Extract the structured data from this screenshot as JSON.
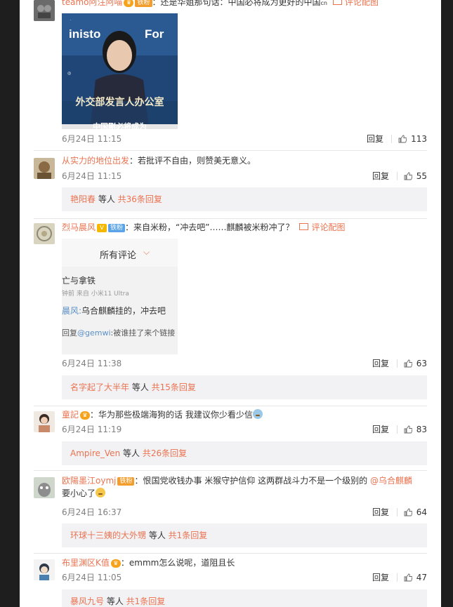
{
  "comments": [
    {
      "user": "teamo阿注阿喵",
      "badge": "铁粉",
      "text": "：还是华姐那句话：中国必将成为更好的中国",
      "cn": "cn",
      "pic_link": "评论配图",
      "image": {
        "banner_top": "inisto",
        "banner_right": "For",
        "caption": "外交部发言人办公室",
        "bottom_text": "中国剛必将成为"
      },
      "time": "6月24日 11:15",
      "reply_label": "回复",
      "likes": "113"
    },
    {
      "user": "从实力的地位出发",
      "text": "：若批评不自由，则赞美无意义。",
      "time": "6月24日 11:15",
      "reply_label": "回复",
      "likes": "55",
      "sub": {
        "user": "艳阳春",
        "etc": " 等人 ",
        "count": "共36条回复"
      }
    },
    {
      "user": "烈马晨风",
      "badge": "铁粉",
      "text": "：来自米粉，“冲去吧”……麒麟被米粉冲了？",
      "pic_link": "评论配图",
      "image": {
        "header": "所有评论",
        "line1": "亡与拿铁",
        "line2": "钟前  来自 小米11 Ultra",
        "line3_user": "晨风:",
        "line3": "乌合麒麟挂的，冲去吧",
        "line4_prefix": "回复",
        "line4_user": "@gemwi",
        "line4": ":被谁挂了来个链接"
      },
      "time": "6月24日 11:38",
      "reply_label": "回复",
      "likes": "63",
      "sub": {
        "user": "名字起了大半年",
        "etc": " 等人 ",
        "count": "共15条回复"
      }
    },
    {
      "user": "童記",
      "text": "：华为那些极端海狗的话 我建议你少看少信",
      "time": "6月24日 11:19",
      "reply_label": "回复",
      "likes": "83",
      "sub": {
        "user": "Ampire_Ven",
        "etc": " 等人 ",
        "count": "共26条回复"
      }
    },
    {
      "user": "欧陽墨江oymj",
      "badge": "铁粉",
      "text": "：恨国党收钱办事 米猴守护信仰 这两群战斗力不是一个级别的 ",
      "mention": "@乌合麒麟",
      "text2": "要小心了",
      "time": "6月24日 16:37",
      "reply_label": "回复",
      "likes": "64",
      "sub": {
        "user": "环球十三姨的大外甥",
        "etc": " 等人 ",
        "count": "共1条回复"
      }
    },
    {
      "user": "布里渊区K值",
      "text": "：emmm怎么说呢，道阻且长",
      "time": "6月24日 11:05",
      "reply_label": "回复",
      "likes": "47",
      "sub": {
        "user": "暴风九号",
        "etc": " 等人 ",
        "count": "共1条回复"
      }
    }
  ],
  "colors": {
    "accent": "#eb7350",
    "subbar": "#f2f2f5",
    "frame": "#1e1e1e"
  }
}
